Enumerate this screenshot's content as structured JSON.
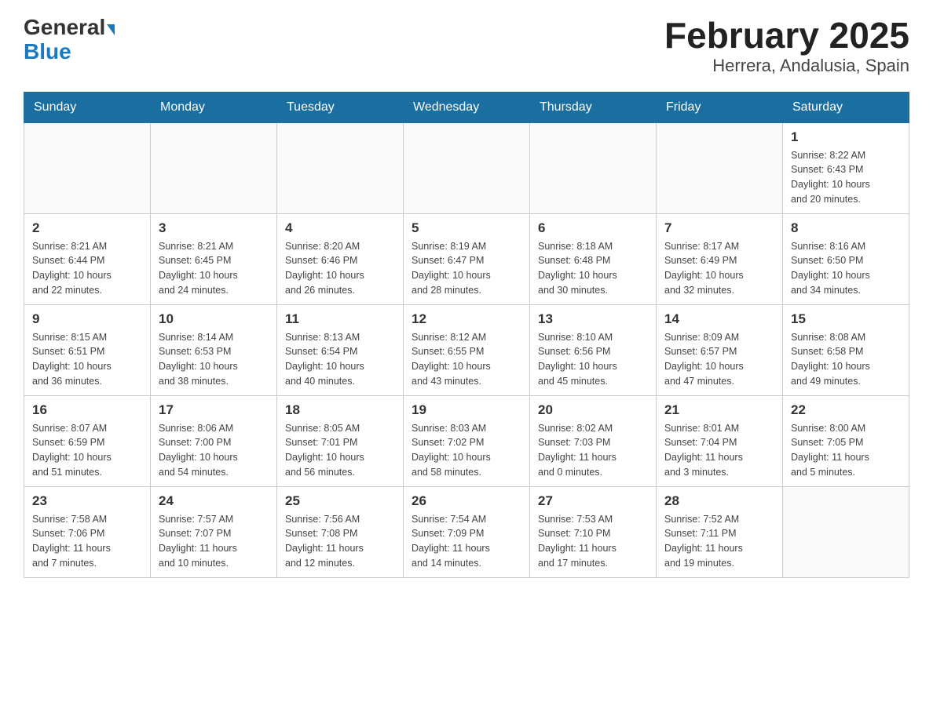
{
  "header": {
    "logo_general": "General",
    "logo_blue": "Blue",
    "title": "February 2025",
    "subtitle": "Herrera, Andalusia, Spain"
  },
  "weekdays": [
    "Sunday",
    "Monday",
    "Tuesday",
    "Wednesday",
    "Thursday",
    "Friday",
    "Saturday"
  ],
  "weeks": [
    [
      {
        "day": "",
        "info": ""
      },
      {
        "day": "",
        "info": ""
      },
      {
        "day": "",
        "info": ""
      },
      {
        "day": "",
        "info": ""
      },
      {
        "day": "",
        "info": ""
      },
      {
        "day": "",
        "info": ""
      },
      {
        "day": "1",
        "info": "Sunrise: 8:22 AM\nSunset: 6:43 PM\nDaylight: 10 hours\nand 20 minutes."
      }
    ],
    [
      {
        "day": "2",
        "info": "Sunrise: 8:21 AM\nSunset: 6:44 PM\nDaylight: 10 hours\nand 22 minutes."
      },
      {
        "day": "3",
        "info": "Sunrise: 8:21 AM\nSunset: 6:45 PM\nDaylight: 10 hours\nand 24 minutes."
      },
      {
        "day": "4",
        "info": "Sunrise: 8:20 AM\nSunset: 6:46 PM\nDaylight: 10 hours\nand 26 minutes."
      },
      {
        "day": "5",
        "info": "Sunrise: 8:19 AM\nSunset: 6:47 PM\nDaylight: 10 hours\nand 28 minutes."
      },
      {
        "day": "6",
        "info": "Sunrise: 8:18 AM\nSunset: 6:48 PM\nDaylight: 10 hours\nand 30 minutes."
      },
      {
        "day": "7",
        "info": "Sunrise: 8:17 AM\nSunset: 6:49 PM\nDaylight: 10 hours\nand 32 minutes."
      },
      {
        "day": "8",
        "info": "Sunrise: 8:16 AM\nSunset: 6:50 PM\nDaylight: 10 hours\nand 34 minutes."
      }
    ],
    [
      {
        "day": "9",
        "info": "Sunrise: 8:15 AM\nSunset: 6:51 PM\nDaylight: 10 hours\nand 36 minutes."
      },
      {
        "day": "10",
        "info": "Sunrise: 8:14 AM\nSunset: 6:53 PM\nDaylight: 10 hours\nand 38 minutes."
      },
      {
        "day": "11",
        "info": "Sunrise: 8:13 AM\nSunset: 6:54 PM\nDaylight: 10 hours\nand 40 minutes."
      },
      {
        "day": "12",
        "info": "Sunrise: 8:12 AM\nSunset: 6:55 PM\nDaylight: 10 hours\nand 43 minutes."
      },
      {
        "day": "13",
        "info": "Sunrise: 8:10 AM\nSunset: 6:56 PM\nDaylight: 10 hours\nand 45 minutes."
      },
      {
        "day": "14",
        "info": "Sunrise: 8:09 AM\nSunset: 6:57 PM\nDaylight: 10 hours\nand 47 minutes."
      },
      {
        "day": "15",
        "info": "Sunrise: 8:08 AM\nSunset: 6:58 PM\nDaylight: 10 hours\nand 49 minutes."
      }
    ],
    [
      {
        "day": "16",
        "info": "Sunrise: 8:07 AM\nSunset: 6:59 PM\nDaylight: 10 hours\nand 51 minutes."
      },
      {
        "day": "17",
        "info": "Sunrise: 8:06 AM\nSunset: 7:00 PM\nDaylight: 10 hours\nand 54 minutes."
      },
      {
        "day": "18",
        "info": "Sunrise: 8:05 AM\nSunset: 7:01 PM\nDaylight: 10 hours\nand 56 minutes."
      },
      {
        "day": "19",
        "info": "Sunrise: 8:03 AM\nSunset: 7:02 PM\nDaylight: 10 hours\nand 58 minutes."
      },
      {
        "day": "20",
        "info": "Sunrise: 8:02 AM\nSunset: 7:03 PM\nDaylight: 11 hours\nand 0 minutes."
      },
      {
        "day": "21",
        "info": "Sunrise: 8:01 AM\nSunset: 7:04 PM\nDaylight: 11 hours\nand 3 minutes."
      },
      {
        "day": "22",
        "info": "Sunrise: 8:00 AM\nSunset: 7:05 PM\nDaylight: 11 hours\nand 5 minutes."
      }
    ],
    [
      {
        "day": "23",
        "info": "Sunrise: 7:58 AM\nSunset: 7:06 PM\nDaylight: 11 hours\nand 7 minutes."
      },
      {
        "day": "24",
        "info": "Sunrise: 7:57 AM\nSunset: 7:07 PM\nDaylight: 11 hours\nand 10 minutes."
      },
      {
        "day": "25",
        "info": "Sunrise: 7:56 AM\nSunset: 7:08 PM\nDaylight: 11 hours\nand 12 minutes."
      },
      {
        "day": "26",
        "info": "Sunrise: 7:54 AM\nSunset: 7:09 PM\nDaylight: 11 hours\nand 14 minutes."
      },
      {
        "day": "27",
        "info": "Sunrise: 7:53 AM\nSunset: 7:10 PM\nDaylight: 11 hours\nand 17 minutes."
      },
      {
        "day": "28",
        "info": "Sunrise: 7:52 AM\nSunset: 7:11 PM\nDaylight: 11 hours\nand 19 minutes."
      },
      {
        "day": "",
        "info": ""
      }
    ]
  ]
}
